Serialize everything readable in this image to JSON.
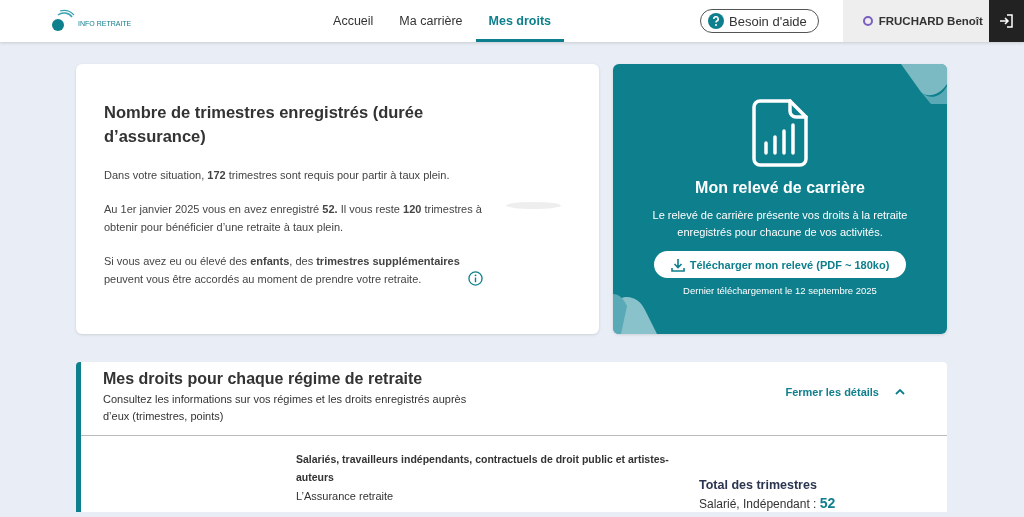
{
  "header": {
    "logo_text": "INFO RETRAITE",
    "nav": [
      {
        "label": "Accueil",
        "selected": false
      },
      {
        "label": "Ma carrière",
        "selected": false
      },
      {
        "label": "Mes droits",
        "selected": true
      }
    ],
    "help_button": "Besoin d'aide",
    "user_name": "FRUCHARD Benoît"
  },
  "quarters_card": {
    "title": "Nombre de trimestres enregistrés (durée d’assurance)",
    "paragraphs": [
      "Dans votre situation, **172** trimestres sont requis pour partir à taux plein.",
      "Au 1er janvier 2025 vous en avez enregistré **52.** Il vous reste **120** trimestres à obtenir pour bénéficier d’une retraite à taux plein.",
      "Si vous avez eu ou élevé des **enfants**, des **trimestres supplémentaires** peuvent vous être accordés au moment de prendre votre retraite."
    ]
  },
  "statement_card": {
    "title": "Mon relevé de carrière",
    "description": "Le relevé de carrière présente vos droits à la retraite enregistrés pour chacune de vos activités.",
    "download_button": "Télécharger mon relevé (PDF ~ 180ko)",
    "last_download": "Dernier téléchargement le 12 septembre 2025"
  },
  "regimes_section": {
    "title": "Mes droits pour chaque régime de retraite",
    "subtitle": "Consultez les informations sur vos régimes et les droits enregistrés auprès d’eux (trimestres, points)",
    "toggle": "Fermer les détails",
    "expanded": true,
    "regime": {
      "name": "Salariés, travailleurs indépendants, contractuels de droit public et artistes-auteurs",
      "organism": "L’Assurance retraite"
    },
    "total": {
      "title": "Total des trimestres",
      "label": "Salarié, Indépendant :",
      "value": "52"
    }
  }
}
